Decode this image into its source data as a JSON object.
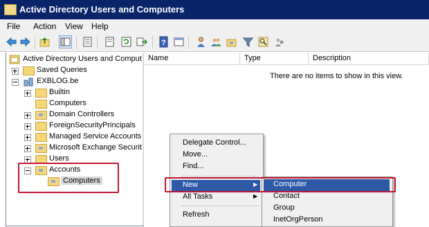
{
  "window": {
    "title": "Active Directory Users and Computers"
  },
  "menubar": {
    "items": [
      "File",
      "Action",
      "View",
      "Help"
    ]
  },
  "toolbar": {
    "icons": [
      "back-arrow-icon",
      "forward-arrow-icon",
      "up-folder-icon",
      "show-console-tree-icon",
      "properties-icon",
      "export-list-icon",
      "refresh-icon",
      "export-icon",
      "help-icon",
      "console-window-icon",
      "new-user-icon",
      "new-group-icon",
      "new-ou-icon",
      "filter-icon",
      "find-icon",
      "add-to-group-icon"
    ]
  },
  "tree": {
    "root": "Active Directory Users and Comput",
    "saved_queries": "Saved Queries",
    "domain": "EXBLOG.be",
    "builtin": "Builtin",
    "computers": "Computers",
    "domain_controllers": "Domain Controllers",
    "foreign_security": "ForeignSecurityPrincipals",
    "managed_service": "Managed Service Accounts",
    "ms_exchange": "Microsoft Exchange Securit",
    "users": "Users",
    "accounts": "Accounts",
    "accounts_computers": "Computers"
  },
  "list": {
    "columns": [
      "Name",
      "Type",
      "Description"
    ],
    "empty_message": "There are no items to show in this view."
  },
  "context_menu": {
    "delegate": "Delegate Control...",
    "move": "Move...",
    "find": "Find...",
    "new": "New",
    "all_tasks": "All Tasks",
    "refresh": "Refresh",
    "arrow": "▶"
  },
  "submenu": {
    "computer": "Computer",
    "contact": "Contact",
    "group": "Group",
    "inetorgperson": "InetOrgPerson"
  },
  "colors": {
    "highlight": "#2d59a7",
    "annotation_box": "#c0152f",
    "titlebar": "#0a246a"
  }
}
